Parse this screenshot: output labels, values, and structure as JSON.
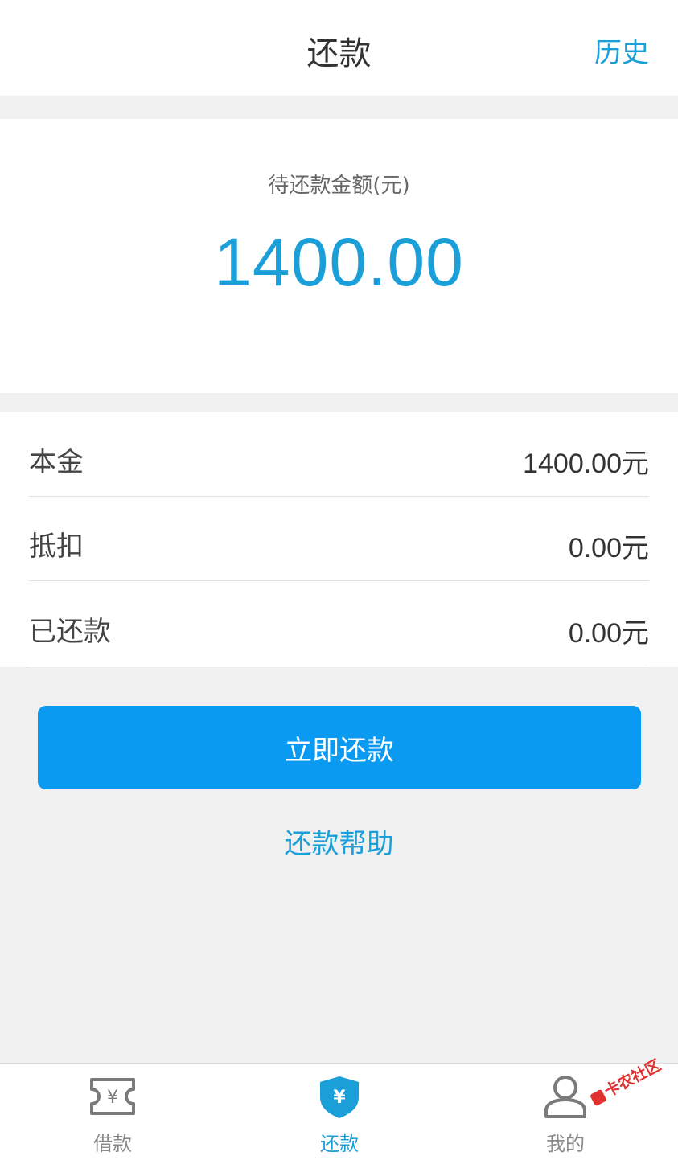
{
  "header": {
    "title": "还款",
    "history_label": "历史"
  },
  "summary": {
    "label": "待还款金额(元)",
    "amount": "1400.00"
  },
  "details": [
    {
      "label": "本金",
      "value": "1400.00元"
    },
    {
      "label": "抵扣",
      "value": "0.00元"
    },
    {
      "label": "已还款",
      "value": "0.00元"
    }
  ],
  "actions": {
    "pay_now_label": "立即还款",
    "help_label": "还款帮助"
  },
  "tabbar": {
    "items": [
      {
        "label": "借款",
        "icon": "ticket-yen-icon",
        "active": false
      },
      {
        "label": "还款",
        "icon": "shield-yen-icon",
        "active": true
      },
      {
        "label": "我的",
        "icon": "user-icon",
        "active": false
      }
    ]
  },
  "watermark": {
    "text": "卡农社区"
  },
  "colors": {
    "accent": "#1a9fd9",
    "button": "#0a9af2",
    "background": "#f0f0f0",
    "tab_inactive": "#8a8a8a"
  }
}
